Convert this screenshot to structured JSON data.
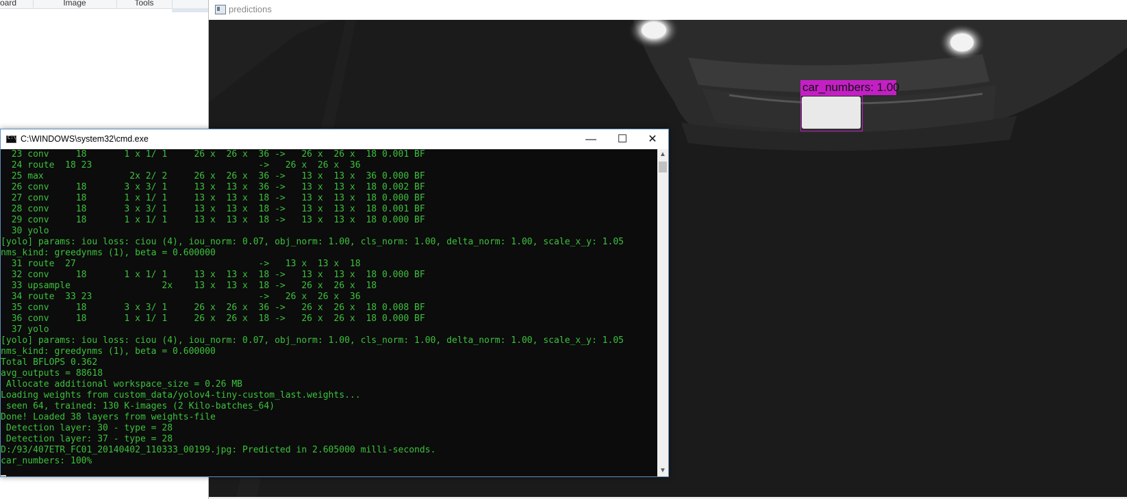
{
  "paint": {
    "tabs": [
      "oard",
      "Image",
      "Tools"
    ]
  },
  "predictions": {
    "title": "predictions",
    "detection_label": "car_numbers: 1.00",
    "detection_color": "#c41fc4"
  },
  "cmd": {
    "title": "C:\\WINDOWS\\system32\\cmd.exe",
    "minimize_glyph": "—",
    "maximize_glyph": "☐",
    "close_glyph": "✕",
    "scroll_up_glyph": "▲",
    "scroll_down_glyph": "▼",
    "text_color": "#3cc13c",
    "lines": [
      "  23 conv     18       1 x 1/ 1     26 x  26 x  36 ->   26 x  26 x  18 0.001 BF",
      "  24 route  18 23                               ->   26 x  26 x  36",
      "  25 max                2x 2/ 2     26 x  26 x  36 ->   13 x  13 x  36 0.000 BF",
      "  26 conv     18       3 x 3/ 1     13 x  13 x  36 ->   13 x  13 x  18 0.002 BF",
      "  27 conv     18       1 x 1/ 1     13 x  13 x  18 ->   13 x  13 x  18 0.000 BF",
      "  28 conv     18       3 x 3/ 1     13 x  13 x  18 ->   13 x  13 x  18 0.001 BF",
      "  29 conv     18       1 x 1/ 1     13 x  13 x  18 ->   13 x  13 x  18 0.000 BF",
      "  30 yolo",
      "[yolo] params: iou loss: ciou (4), iou_norm: 0.07, obj_norm: 1.00, cls_norm: 1.00, delta_norm: 1.00, scale_x_y: 1.05",
      "nms_kind: greedynms (1), beta = 0.600000",
      "  31 route  27                                  ->   13 x  13 x  18",
      "  32 conv     18       1 x 1/ 1     13 x  13 x  18 ->   13 x  13 x  18 0.000 BF",
      "  33 upsample                 2x    13 x  13 x  18 ->   26 x  26 x  18",
      "  34 route  33 23                               ->   26 x  26 x  36",
      "  35 conv     18       3 x 3/ 1     26 x  26 x  36 ->   26 x  26 x  18 0.008 BF",
      "  36 conv     18       1 x 1/ 1     26 x  26 x  18 ->   26 x  26 x  18 0.000 BF",
      "  37 yolo",
      "[yolo] params: iou loss: ciou (4), iou_norm: 0.07, obj_norm: 1.00, cls_norm: 1.00, delta_norm: 1.00, scale_x_y: 1.05",
      "nms_kind: greedynms (1), beta = 0.600000",
      "Total BFLOPS 0.362",
      "avg_outputs = 88618",
      " Allocate additional workspace_size = 0.26 MB",
      "Loading weights from custom_data/yolov4-tiny-custom_last.weights...",
      " seen 64, trained: 130 K-images (2 Kilo-batches_64)",
      "Done! Loaded 38 layers from weights-file",
      " Detection layer: 30 - type = 28",
      " Detection layer: 37 - type = 28",
      "D:/93/407ETR_FC01_20140402_110333_00199.jpg: Predicted in 2.605000 milli-seconds.",
      "car_numbers: 100%"
    ]
  }
}
